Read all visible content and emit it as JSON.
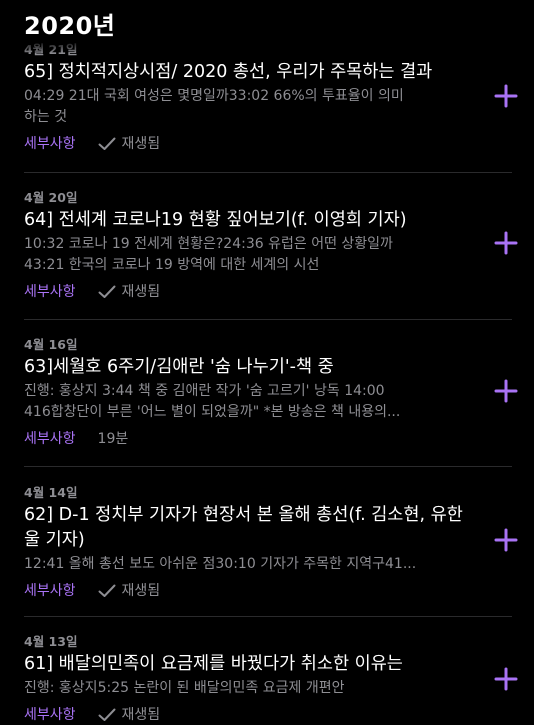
{
  "header": {
    "title": "2020년"
  },
  "colors": {
    "accent": "#a973f5",
    "muted": "#8e8e93",
    "background": "#000000"
  },
  "episodes": [
    {
      "date": "4월 21일",
      "title": "65] 정치적지상시점/ 2020 총선, 우리가 주목하는 결과",
      "description": "04:29 21대 국회 여성은 몇명일까33:02 66%의 투표율이 의미\n하는 것",
      "details_label": "세부사항",
      "status": "재생됨",
      "status_icon": "checkmark-icon"
    },
    {
      "date": "4월 20일",
      "title": "64] 전세계 코로나19 현황 짚어보기(f. 이영희 기자)",
      "description": "10:32 코로나 19 전세계 현황은?24:36 유럽은 어떤 상황일까\n43:21 한국의 코로나 19 방역에 대한 세계의 시선",
      "details_label": "세부사항",
      "status": "재생됨",
      "status_icon": "checkmark-icon"
    },
    {
      "date": "4월 16일",
      "title": "63]세월호 6주기/김애란 '숨 나누기'-책  중",
      "description": "진행: 홍상지 3:44 책  중 김애란 작가 '숨 고르기' 낭독 14:00\n416합창단이 부른 '어느 별이 되었을까\" *본 방송은 책  내용의...",
      "details_label": "세부사항",
      "status": "19분",
      "status_icon": ""
    },
    {
      "date": "4월 14일",
      "title": "62] D-1 정치부 기자가 현장서 본 올해 총선(f. 김소현, 유한울 기자)",
      "description": "12:41 올해 총선 보도 아쉬운 점30:10 기자가 주목한 지역구41...",
      "details_label": "세부사항",
      "status": "재생됨",
      "status_icon": "checkmark-icon"
    },
    {
      "date": "4월 13일",
      "title": "61] 배달의민족이 요금제를 바꿨다가 취소한 이유는",
      "description": "진행: 홍상지5:25 논란이 된 배달의민족 요금제 개편안",
      "details_label": "세부사항",
      "status": "재생됨",
      "status_icon": "checkmark-icon"
    }
  ]
}
